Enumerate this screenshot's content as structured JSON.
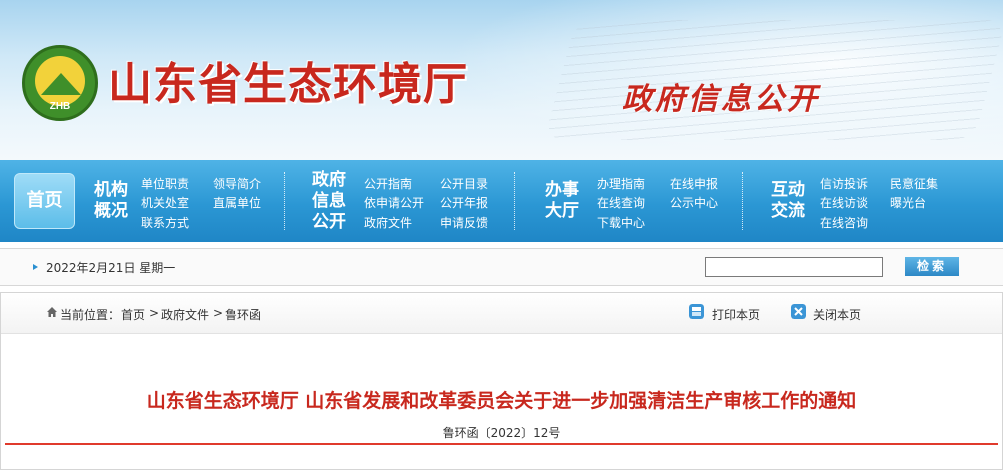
{
  "header": {
    "logo_text": "ZHB",
    "site_title": "山东省生态环境厅",
    "section_title": "政府信息公开"
  },
  "nav": {
    "home": "首页",
    "groups": [
      {
        "title_lines": [
          "机构",
          "概况"
        ],
        "links": [
          "单位职责",
          "领导简介",
          "机关处室",
          "直属单位",
          "联系方式"
        ]
      },
      {
        "title_lines": [
          "政府",
          "信息",
          "公开"
        ],
        "links": [
          "公开指南",
          "公开目录",
          "依申请公开",
          "公开年报",
          "政府文件",
          "申请反馈"
        ]
      },
      {
        "title_lines": [
          "办事",
          "大厅"
        ],
        "links": [
          "办理指南",
          "在线申报",
          "在线查询",
          "公示中心",
          "下载中心"
        ]
      },
      {
        "title_lines": [
          "互动",
          "交流"
        ],
        "links": [
          "信访投诉",
          "民意征集",
          "在线访谈",
          "曝光台",
          "在线咨询"
        ]
      }
    ]
  },
  "datebar": {
    "date": "2022年2月21日 星期一",
    "search_value": "",
    "search_button": "检索"
  },
  "breadcrumb": {
    "prefix": "当前位置：",
    "items": [
      "首页",
      "政府文件",
      "鲁环函"
    ],
    "separator": ">"
  },
  "tools": {
    "print": "打印本页",
    "close": "关闭本页"
  },
  "document": {
    "title": "山东省生态环境厅 山东省发展和改革委员会关于进一步加强清洁生产审核工作的通知",
    "number": "鲁环函〔2022〕12号"
  },
  "colors": {
    "brand_red": "#c8281e",
    "nav_blue": "#2b97d4"
  }
}
